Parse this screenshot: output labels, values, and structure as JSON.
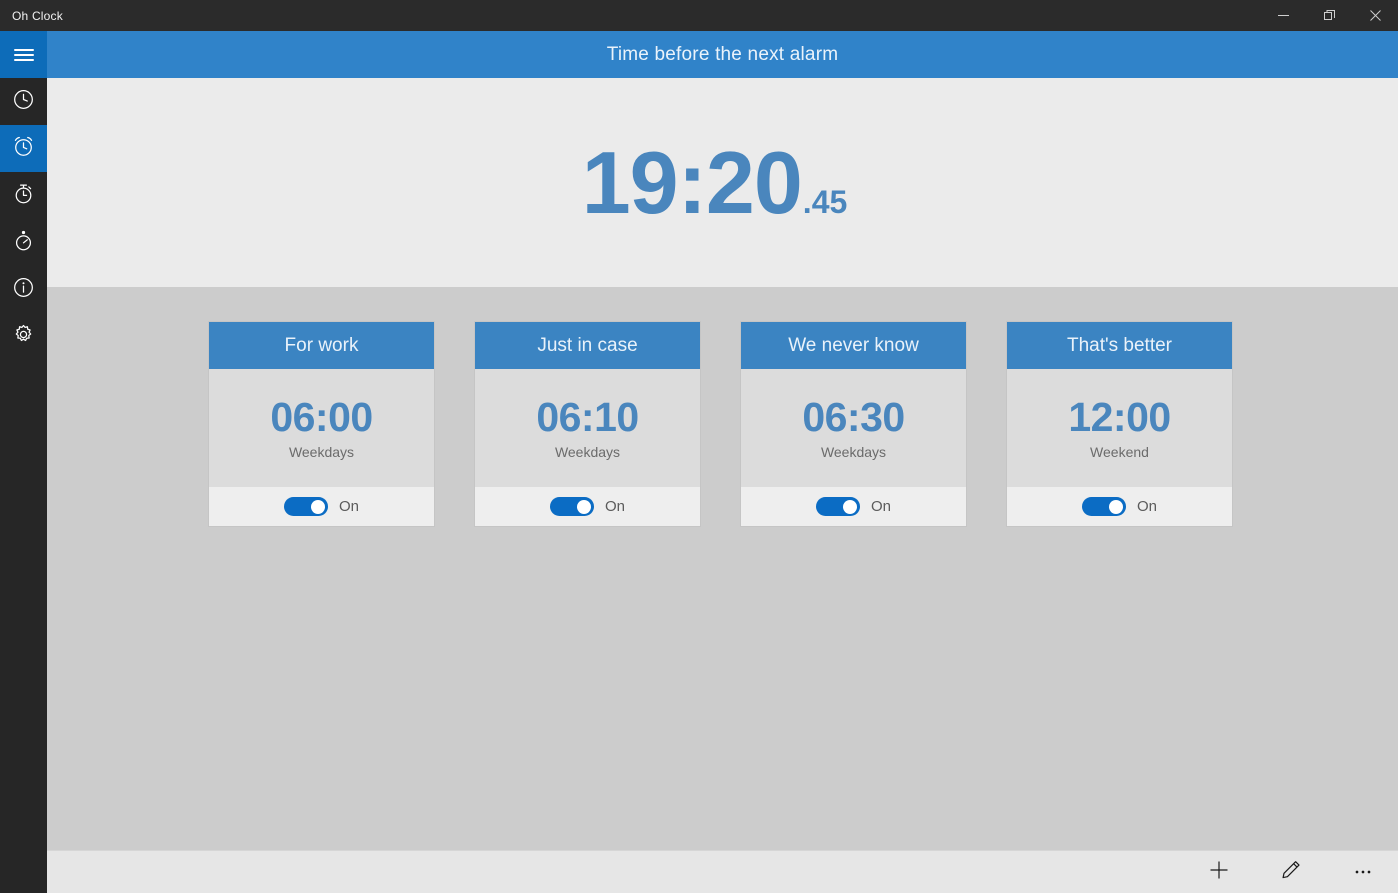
{
  "window": {
    "title": "Oh Clock",
    "controls": [
      {
        "name": "minimize-button",
        "glyph": "–"
      },
      {
        "name": "restore-button",
        "glyph": "❐"
      },
      {
        "name": "close-button",
        "glyph": "✕"
      }
    ]
  },
  "sidebar": {
    "menu_label": "Menu",
    "items": [
      {
        "icon": "clock-icon",
        "label": "Clock",
        "selected": false
      },
      {
        "icon": "alarm-icon",
        "label": "Alarm",
        "selected": true
      },
      {
        "icon": "stopwatch-icon",
        "label": "Stopwatch",
        "selected": false
      },
      {
        "icon": "timer-icon",
        "label": "Timer",
        "selected": false
      },
      {
        "icon": "info-icon",
        "label": "About",
        "selected": false
      },
      {
        "icon": "gear-icon",
        "label": "Settings",
        "selected": false
      }
    ]
  },
  "header": {
    "title": "Time before the next alarm"
  },
  "countdown": {
    "time": "19:20",
    "fraction": ".45"
  },
  "alarms": [
    {
      "title": "For work",
      "time": "06:00",
      "repeat": "Weekdays",
      "state": "On",
      "enabled": true
    },
    {
      "title": "Just in case",
      "time": "06:10",
      "repeat": "Weekdays",
      "state": "On",
      "enabled": true
    },
    {
      "title": "We never know",
      "time": "06:30",
      "repeat": "Weekdays",
      "state": "On",
      "enabled": true
    },
    {
      "title": "That's better",
      "time": "12:00",
      "repeat": "Weekend",
      "state": "On",
      "enabled": true
    }
  ],
  "appbar": {
    "buttons": [
      {
        "name": "add-alarm-button",
        "icon": "plus-icon",
        "label": "Add"
      },
      {
        "name": "edit-alarm-button",
        "icon": "pencil-icon",
        "label": "Edit"
      },
      {
        "name": "more-options-button",
        "icon": "ellipsis-icon",
        "label": "More"
      }
    ]
  },
  "colors": {
    "accent": "#3083c9",
    "accent_dark": "#0d6cb9",
    "time_blue": "#4a86bd",
    "toggle_on": "#0b6cc4",
    "titlebar": "#2b2b2b",
    "panel_light": "#ebebeb",
    "list_bg": "#cccccc",
    "card_bg": "#dcdcdc",
    "card_foot": "#eeeeee",
    "appbar": "#e6e6e6"
  }
}
